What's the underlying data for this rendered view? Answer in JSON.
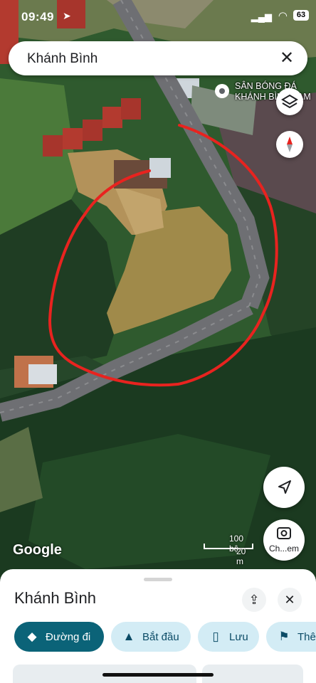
{
  "status_bar": {
    "time": "09:49",
    "battery": "63"
  },
  "search": {
    "query": "Khánh Bình"
  },
  "poi": {
    "label_line1": "SÂN BÓNG ĐÁ",
    "label_line2": "KHÁNH BÌNH TẠM"
  },
  "map": {
    "attribution": "Google",
    "scale_imperial": "100 bộ",
    "scale_metric": "20 m",
    "annotation_color": "#e8231f"
  },
  "controls": {
    "lens_label": "Ch...em"
  },
  "sheet": {
    "title": "Khánh Bình",
    "chips": [
      {
        "label": "Đường đi",
        "icon": "directions-icon"
      },
      {
        "label": "Bắt đầu",
        "icon": "navigation-icon"
      },
      {
        "label": "Lưu",
        "icon": "bookmark-icon"
      },
      {
        "label": "Thê",
        "icon": "flag-icon"
      }
    ]
  },
  "colors": {
    "accent": "#0b6378",
    "chip_bg": "#d3ecf5"
  }
}
